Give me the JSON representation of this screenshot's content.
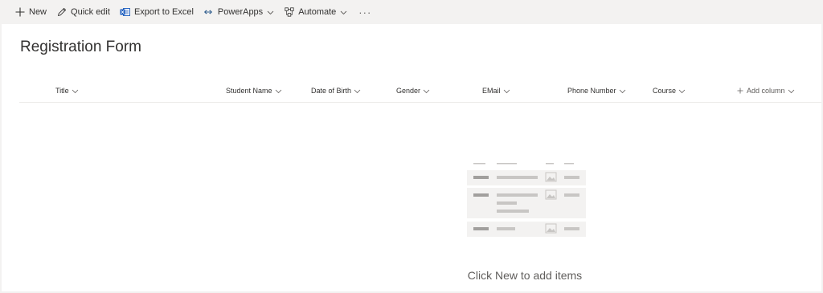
{
  "toolbar": {
    "new_label": "New",
    "quick_edit_label": "Quick edit",
    "export_label": "Export to Excel",
    "powerapps_label": "PowerApps",
    "automate_label": "Automate",
    "more_label": "···"
  },
  "list": {
    "title": "Registration Form",
    "columns": [
      "Title",
      "Student Name",
      "Date of Birth",
      "Gender",
      "EMail",
      "Phone Number",
      "Course"
    ],
    "add_column_label": "Add column"
  },
  "empty_state": {
    "message": "Click New to add items"
  },
  "colors": {
    "accent": "#0078d4",
    "excel_blue": "#185abd",
    "powerapps_blue": "#2f5c8c",
    "placeholder_dark": "#a19f9d",
    "placeholder_light": "#c8c6c4",
    "placeholder_bg": "#f3f2f1"
  }
}
